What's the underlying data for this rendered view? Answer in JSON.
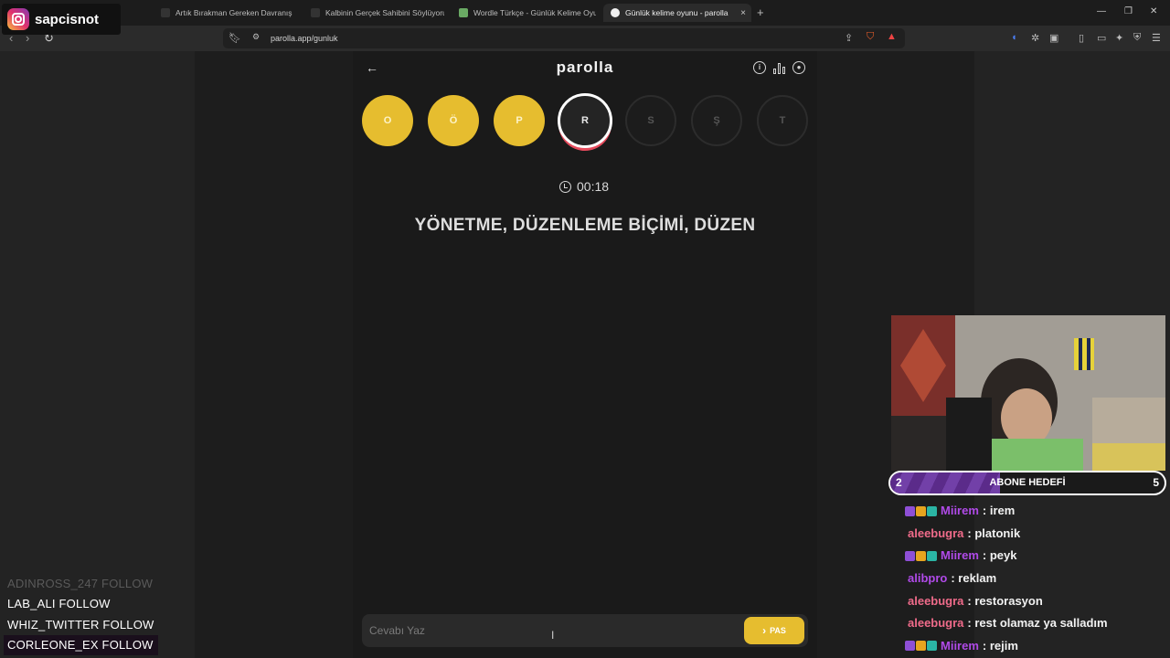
{
  "overlay": {
    "instagram": "sapcisnot"
  },
  "browser": {
    "tabs": [
      {
        "title": "Artık Bırakman Gereken Davranış Ha",
        "favicon_color": "#1a1a1a"
      },
      {
        "title": "Kalbinin Gerçek Sahibini Söylüyoruz!",
        "favicon_color": "#1a1a1a"
      },
      {
        "title": "Wordle Türkçe - Günlük Kelime Oyun",
        "favicon_color": "#6aaa64"
      },
      {
        "title": "Günlük kelime oyunu - parolla",
        "favicon_color": "#e6bd2f"
      }
    ],
    "active_tab_close": "×",
    "new_tab": "+",
    "url": "parolla.app/gunluk"
  },
  "app": {
    "brand": "parolla",
    "back_icon": "←",
    "info_icon": "i",
    "letters": [
      {
        "char": "O",
        "state": "done"
      },
      {
        "char": "Ö",
        "state": "done"
      },
      {
        "char": "P",
        "state": "done"
      },
      {
        "char": "R",
        "state": "current"
      },
      {
        "char": "S",
        "state": "todo"
      },
      {
        "char": "Ş",
        "state": "todo"
      },
      {
        "char": "T",
        "state": "todo"
      }
    ],
    "timer": "00:18",
    "question": "YÖNETME, DÜZENLEME BİÇİMİ, DÜZEN",
    "answer_placeholder": "Cevabı Yaz",
    "pass_label": "PAS",
    "pass_icon": "›"
  },
  "follows": [
    {
      "name": "ADINROSS_247",
      "action": "FOLLOW",
      "style": "faded"
    },
    {
      "name": "LAB_ALI",
      "action": "FOLLOW",
      "style": "normal"
    },
    {
      "name": "WHIZ_TWITTER",
      "action": "FOLLOW",
      "style": "normal"
    },
    {
      "name": "CORLEONE_EX",
      "action": "FOLLOW",
      "style": "highlight"
    }
  ],
  "sub_goal": {
    "current": "2",
    "title": "ABONE HEDEFİ",
    "target": "5",
    "progress": 0.4
  },
  "chat": [
    {
      "user": "Miirem",
      "text": ": irem",
      "color": "#b04ae8",
      "badges": true
    },
    {
      "user": "aleebugra",
      "text": ": platonik",
      "color": "#ef6b8a",
      "badges": false
    },
    {
      "user": "Miirem",
      "text": ": peyk",
      "color": "#b04ae8",
      "badges": true
    },
    {
      "user": "alibpro",
      "text": ": reklam",
      "color": "#b04ae8",
      "badges": false
    },
    {
      "user": "aleebugra",
      "text": ": restorasyon",
      "color": "#ef6b8a",
      "badges": false
    },
    {
      "user": "aleebugra",
      "text": ": rest olamaz ya salladım",
      "color": "#ef6b8a",
      "badges": false
    },
    {
      "user": "Miirem",
      "text": ": rejim",
      "color": "#b04ae8",
      "badges": true
    }
  ]
}
